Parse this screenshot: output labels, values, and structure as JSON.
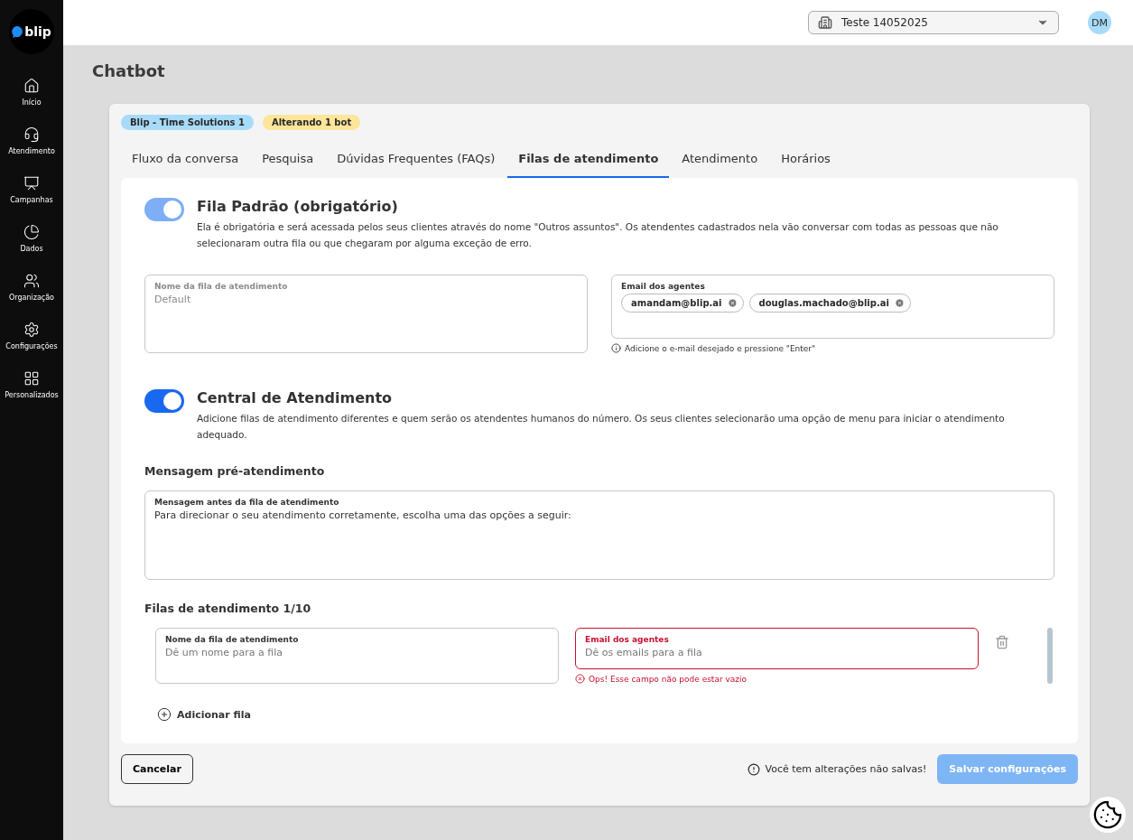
{
  "sidebar": {
    "logo": "blip",
    "items": [
      {
        "label": "Início",
        "selected": false
      },
      {
        "label": "Atendimento",
        "selected": false
      },
      {
        "label": "Campanhas",
        "selected": false
      },
      {
        "label": "Dados",
        "selected": false
      },
      {
        "label": "Organização",
        "selected": false
      },
      {
        "label": "Configurações",
        "selected": false
      },
      {
        "label": "Personalizados",
        "selected": false
      }
    ]
  },
  "topbar": {
    "contract": "Teste 14052025",
    "avatar": "DM"
  },
  "page_title": "Chatbot",
  "badges": [
    {
      "label": "Blip - Time Solutions 1",
      "color": "#a8dbf9"
    },
    {
      "label": "Alterando 1 bot",
      "color": "#fde59a"
    }
  ],
  "tabs": [
    {
      "label": "Fluxo da conversa",
      "selected": false
    },
    {
      "label": "Pesquisa",
      "selected": false
    },
    {
      "label": "Dúvidas Frequentes (FAQs)",
      "selected": false
    },
    {
      "label": "Filas de atendimento",
      "selected": true
    },
    {
      "label": "Atendimento",
      "selected": false
    },
    {
      "label": "Horários",
      "selected": false
    }
  ],
  "default_queue": {
    "title": "Fila Padrão (obrigatório)",
    "on": true,
    "disabled": true,
    "description": "Ela é obrigatória e será acessada pelos seus clientes através do nome \"Outros assuntos\". Os atendentes cadastrados nela vão conversar com todas as pessoas que não selecionaram outra fila ou que chegaram por alguma exceção de erro.",
    "name_field": {
      "label": "Nome da fila de atendimento",
      "value": "Default",
      "disabled": true
    },
    "email_field": {
      "label": "Email dos agentes",
      "chips": [
        "amandam@blip.ai",
        "douglas.machado@blip.ai"
      ],
      "hint": "Adicione o e-mail desejado e pressione \"Enter\""
    }
  },
  "service_center": {
    "title": "Central de Atendimento",
    "on": true,
    "disabled": false,
    "description": "Adicione filas de atendimento diferentes e quem serão os atendentes humanos do número. Os seus clientes selecionarão uma opção de menu para iniciar o atendimento adequado."
  },
  "pre_message": {
    "heading": "Mensagem pré-atendimento",
    "label": "Mensagem antes da fila de atendimento",
    "value": "Para direcionar o seu atendimento corretamente, escolha uma das opções a seguir:"
  },
  "queues": {
    "heading": "Filas de atendimento 1/10",
    "rows": [
      {
        "name_label": "Nome da fila de atendimento",
        "name_placeholder": "Dê um nome para a fila",
        "email_label": "Email dos agentes",
        "email_placeholder": "Dê os emails para a fila",
        "error": "Ops! Esse campo não pode estar vazio"
      }
    ],
    "add": "Adicionar fila"
  },
  "footer": {
    "cancel": "Cancelar",
    "warning": "Você tem alterações não salvas!",
    "save": "Salvar configurações",
    "save_disabled": true
  }
}
